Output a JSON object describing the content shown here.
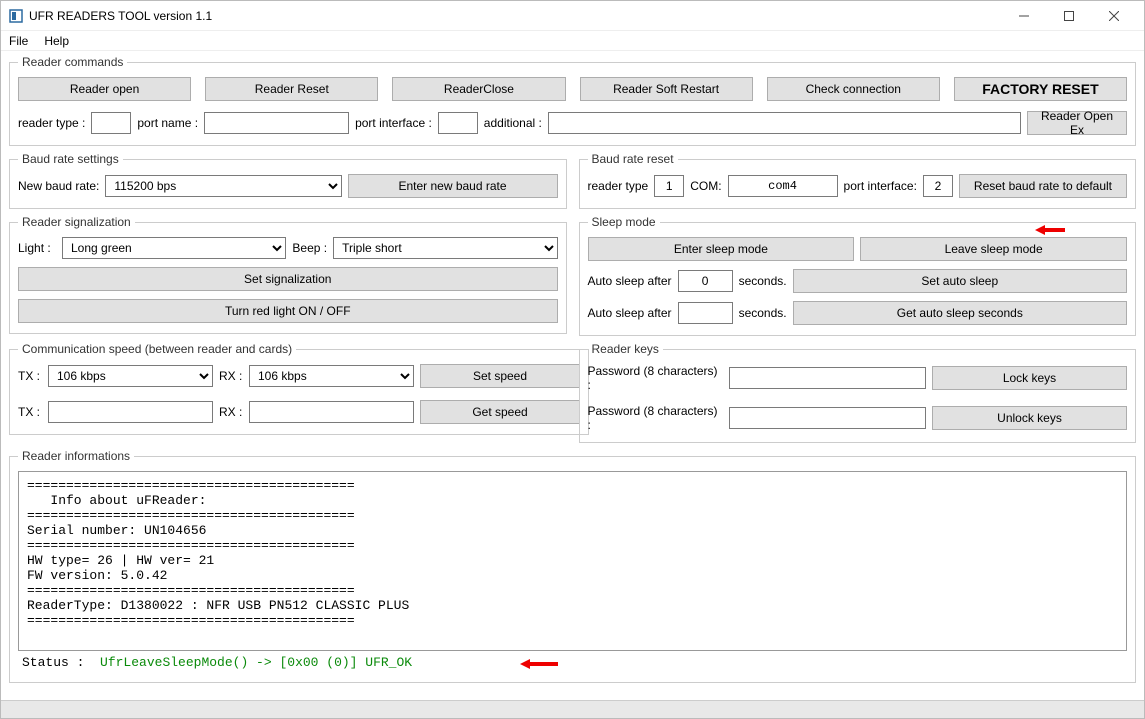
{
  "window": {
    "title": "UFR READERS TOOL version 1.1"
  },
  "menu": {
    "file": "File",
    "help": "Help"
  },
  "commands": {
    "legend": "Reader commands",
    "open": "Reader open",
    "reset": "Reader Reset",
    "close": "ReaderClose",
    "soft_restart": "Reader Soft Restart",
    "check_conn": "Check connection",
    "factory_reset": "FACTORY RESET",
    "reader_type_lbl": "reader type :",
    "port_name_lbl": "port name :",
    "port_iface_lbl": "port interface :",
    "additional_lbl": "additional :",
    "open_ex": "Reader Open Ex",
    "reader_type": "",
    "port_name": "",
    "port_iface": "",
    "additional": ""
  },
  "baud": {
    "legend": "Baud rate settings",
    "new_lbl": "New baud rate:",
    "value": "115200 bps",
    "enter": "Enter new baud rate"
  },
  "baud_reset": {
    "legend": "Baud rate reset",
    "reader_type_lbl": "reader type",
    "reader_type": "1",
    "com_lbl": "COM:",
    "com": "com4",
    "port_iface_lbl": "port interface:",
    "port_iface": "2",
    "reset_btn": "Reset baud rate to default"
  },
  "signal": {
    "legend": "Reader signalization",
    "light_lbl": "Light :",
    "light": "Long green",
    "beep_lbl": "Beep :",
    "beep": "Triple short",
    "set": "Set signalization",
    "red": "Turn red light ON / OFF"
  },
  "sleep": {
    "legend": "Sleep mode",
    "enter": "Enter sleep mode",
    "leave": "Leave sleep mode",
    "auto_lbl": "Auto sleep after",
    "seconds_lbl": "seconds.",
    "val1": "0",
    "val2": "",
    "set_auto": "Set auto sleep",
    "get_auto": "Get auto sleep seconds"
  },
  "comm": {
    "legend": "Communication speed (between reader and cards)",
    "tx_lbl": "TX :",
    "rx_lbl": "RX :",
    "tx": "106 kbps",
    "rx": "106 kbps",
    "tx2": "",
    "rx2": "",
    "set": "Set speed",
    "get": "Get speed"
  },
  "keys": {
    "legend": "Reader keys",
    "pw_lbl": "Password (8 characters) :",
    "pw1": "",
    "pw2": "",
    "lock": "Lock keys",
    "unlock": "Unlock keys"
  },
  "info": {
    "legend": "Reader informations",
    "text": "==========================================\n   Info about uFReader:\n==========================================\nSerial number: UN104656\n==========================================\nHW type= 26 | HW ver= 21\nFW version: 5.0.42\n==========================================\nReaderType: D1380022 : NFR USB PN512 CLASSIC PLUS\n=========================================="
  },
  "status": {
    "label": "Status :",
    "msg": "UfrLeaveSleepMode() -> [0x00 (0)] UFR_OK"
  }
}
